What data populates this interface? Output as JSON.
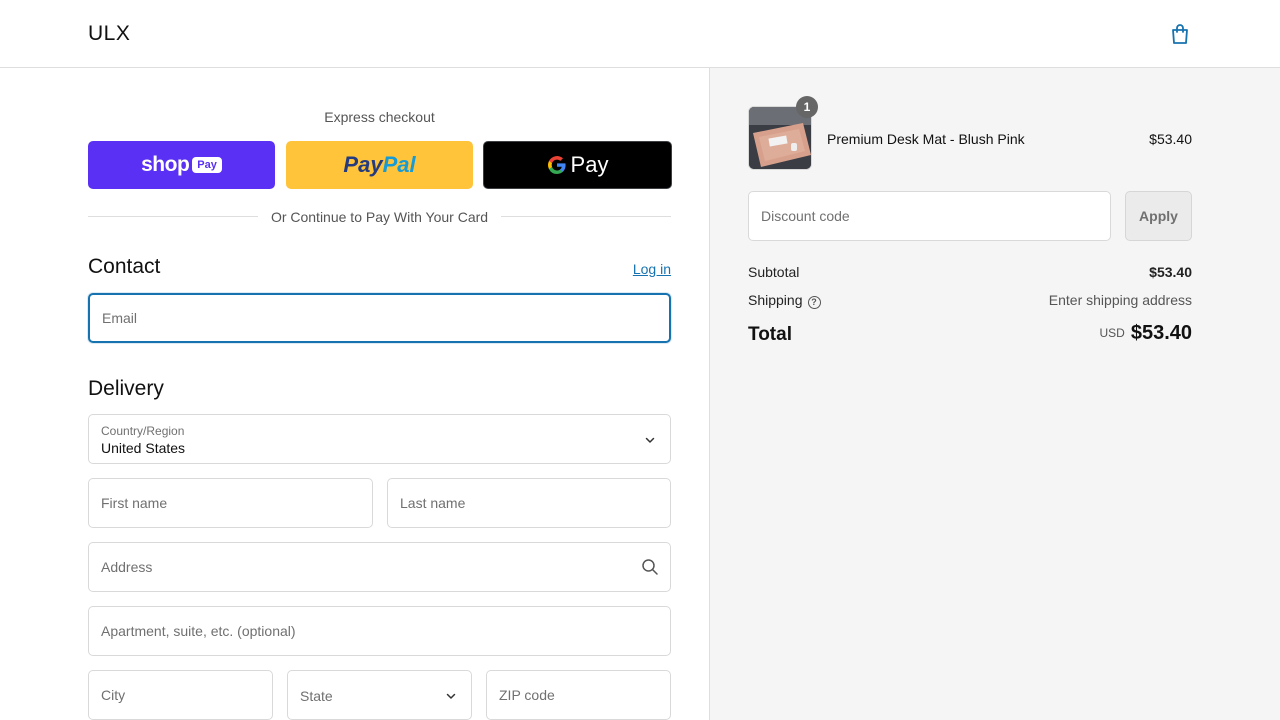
{
  "header": {
    "logo": "ULX",
    "cart_icon": "shopping-bag-icon"
  },
  "express": {
    "title": "Express checkout",
    "shop_pay": {
      "word": "shop",
      "badge": "Pay"
    },
    "paypal": {
      "part1": "Pay",
      "part2": "Pal"
    },
    "gpay": {
      "g": "G",
      "word": "Pay"
    },
    "divider": "Or Continue to Pay With Your Card"
  },
  "contact": {
    "title": "Contact",
    "login": "Log in",
    "email_placeholder": "Email"
  },
  "delivery": {
    "title": "Delivery",
    "country_label": "Country/Region",
    "country_value": "United States",
    "first_name_placeholder": "First name",
    "last_name_placeholder": "Last name",
    "address_placeholder": "Address",
    "apartment_placeholder": "Apartment, suite, etc. (optional)",
    "city_placeholder": "City",
    "state_placeholder": "State",
    "zip_placeholder": "ZIP code"
  },
  "summary": {
    "item": {
      "quantity": "1",
      "name": "Premium Desk Mat - Blush Pink",
      "price": "$53.40"
    },
    "discount_placeholder": "Discount code",
    "apply_label": "Apply",
    "subtotal_label": "Subtotal",
    "subtotal_value": "$53.40",
    "shipping_label": "Shipping",
    "shipping_value": "Enter shipping address",
    "total_label": "Total",
    "total_currency": "USD",
    "total_value": "$53.40"
  },
  "colors": {
    "accent": "#1773b0",
    "shop_pay": "#5a31f4",
    "paypal": "#ffc439",
    "summary_bg": "#f5f5f5"
  }
}
